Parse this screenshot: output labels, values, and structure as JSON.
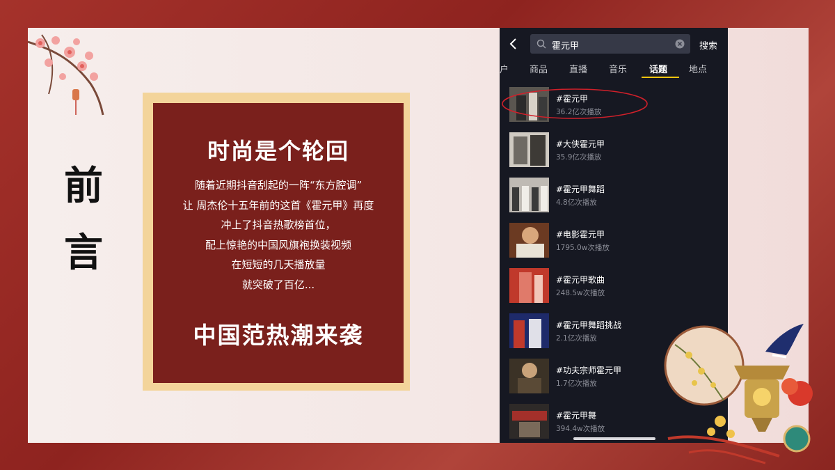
{
  "slide": {
    "title_chars": [
      "前",
      "言"
    ],
    "card": {
      "heading": "时尚是个轮回",
      "lines": [
        "随着近期抖音刮起的一阵“东方腔调”",
        "让 周杰伦十五年前的这首《霍元甲》再度",
        "冲上了抖音热歌榜首位，",
        "配上惊艳的中国风旗袍换装视频",
        "在短短的几天播放量",
        "就突破了百亿..."
      ],
      "footer": "中国范热潮来袭"
    }
  },
  "phone": {
    "search": {
      "query": "霍元甲",
      "button": "搜索"
    },
    "tabs": [
      {
        "label": "户",
        "active": false
      },
      {
        "label": "商品",
        "active": false
      },
      {
        "label": "直播",
        "active": false
      },
      {
        "label": "音乐",
        "active": false
      },
      {
        "label": "话题",
        "active": true
      },
      {
        "label": "地点",
        "active": false
      }
    ],
    "results": [
      {
        "title": "#霍元甲",
        "count": "36.2亿次播放"
      },
      {
        "title": "#大侠霍元甲",
        "count": "35.9亿次播放"
      },
      {
        "title": "#霍元甲舞蹈",
        "count": "4.8亿次播放"
      },
      {
        "title": "#电影霍元甲",
        "count": "1795.0w次播放"
      },
      {
        "title": "#霍元甲歌曲",
        "count": "248.5w次播放"
      },
      {
        "title": "#霍元甲舞蹈挑战",
        "count": "2.1亿次播放"
      },
      {
        "title": "#功夫宗师霍元甲",
        "count": "1.7亿次播放"
      },
      {
        "title": "#霍元甲舞",
        "count": "394.4w次播放"
      }
    ]
  },
  "colors": {
    "outer_background": "#a5322b",
    "card_red": "#7a201c",
    "card_border": "#f3d49a",
    "phone_background": "#161822",
    "active_tab_underline": "#f1c40f",
    "highlight_ellipse": "#d0202a"
  },
  "icons": {
    "back": "chevron-left-icon",
    "search": "search-icon",
    "clear": "clear-circle-icon"
  }
}
